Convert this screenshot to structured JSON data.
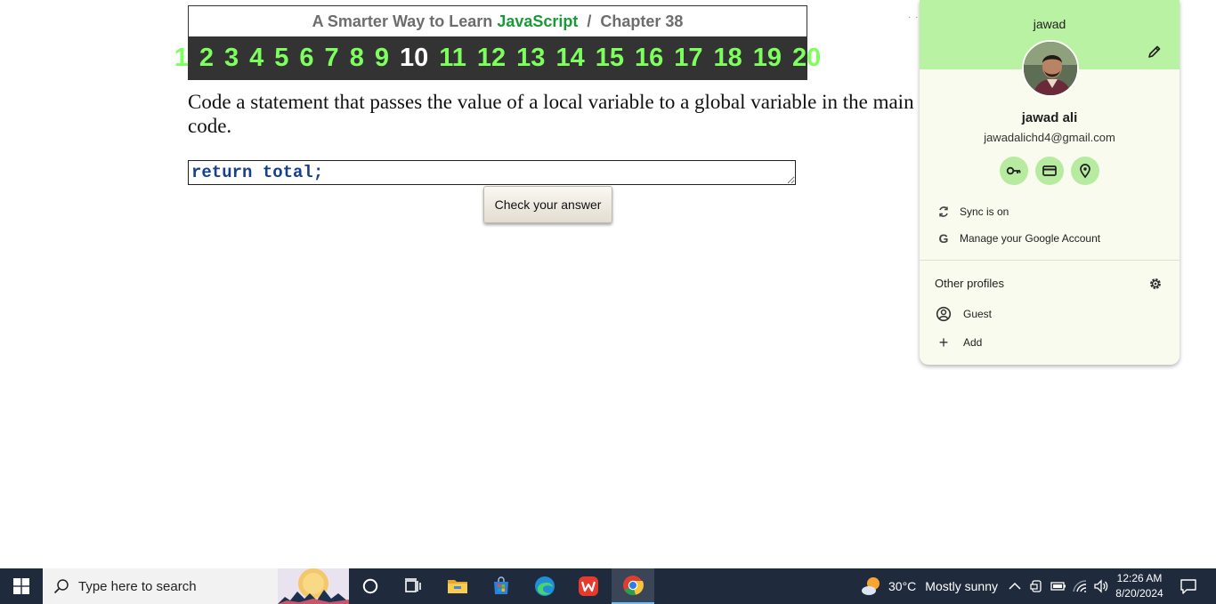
{
  "header": {
    "title_prefix": "A Smarter Way to Learn ",
    "title_brand": "JavaScript",
    "title_suffix": "  /  Chapter 38",
    "chapters": [
      "1",
      "2",
      "3",
      "4",
      "5",
      "6",
      "7",
      "8",
      "9",
      "10",
      "11",
      "12",
      "13",
      "14",
      "15",
      "16",
      "17",
      "18",
      "19",
      "20"
    ],
    "current_chapter": "10",
    "colors": {
      "chapter_link": "#7dff5e",
      "current": "#ffffff",
      "brand": "#1a9a37",
      "bar": "#333333"
    }
  },
  "exercise": {
    "question": "Code a statement that passes the value of a local variable to a global variable in the main code.",
    "answer_value": "return total;",
    "check_label": "Check your answer"
  },
  "profile": {
    "top_name": "jawad",
    "full_name": "jawad ali",
    "email": "jawadalichd4@gmail.com",
    "quick_icons": [
      "key-icon",
      "credit-card-icon",
      "location-pin-icon"
    ],
    "sync_label": "Sync is on",
    "manage_label": "Manage your Google Account",
    "other_profiles_label": "Other profiles",
    "guest_label": "Guest",
    "add_label": "Add",
    "colors": {
      "banner": "#baf2a3",
      "panel": "#f8fbee"
    }
  },
  "taskbar": {
    "search_placeholder": "Type here to search",
    "apps": [
      "cortana-icon",
      "task-view-icon",
      "file-explorer-icon",
      "microsoft-store-icon",
      "edge-icon",
      "wps-office-icon",
      "chrome-icon"
    ],
    "active_app": "chrome-icon",
    "weather_temp": "30°C",
    "weather_desc": "Mostly sunny",
    "time": "12:26 AM",
    "date": "8/20/2024"
  }
}
